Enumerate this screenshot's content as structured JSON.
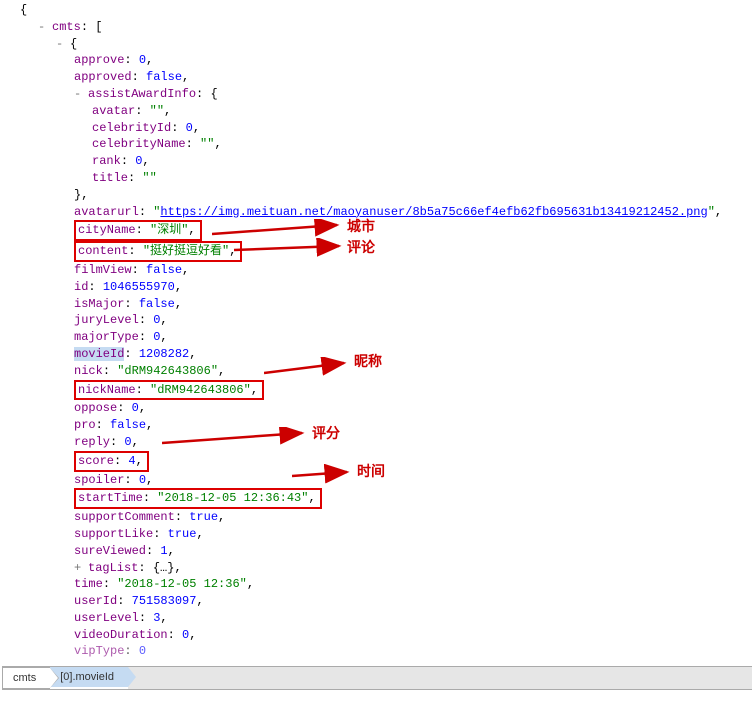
{
  "tree": {
    "open_brace": "{",
    "cmts_key": "cmts",
    "open_bracket": "[",
    "item_open": "{",
    "approve_k": "approve",
    "approve_v": "0",
    "approved_k": "approved",
    "approved_v": "false",
    "assist_k": "assistAwardInfo",
    "assist_open": "{",
    "avatar_k": "avatar",
    "avatar_v": "\"\"",
    "celebId_k": "celebrityId",
    "celebId_v": "0",
    "celebName_k": "celebrityName",
    "celebName_v": "\"\"",
    "rank_k": "rank",
    "rank_v": "0",
    "title_k": "title",
    "title_v": "\"\"",
    "assist_close": "}",
    "avatarurl_k": "avatarurl",
    "avatarurl_q": "\"",
    "avatarurl_link": "https://img.meituan.net/maoyanuser/8b5a75c66ef4efb62fb695631b13419212452.png",
    "cityName_k": "cityName",
    "cityName_v": "\"深圳\"",
    "content_k": "content",
    "content_v": "\"挺好挺逗好看\"",
    "filmView_k": "filmView",
    "filmView_v": "false",
    "id_k": "id",
    "id_v": "1046555970",
    "isMajor_k": "isMajor",
    "isMajor_v": "false",
    "juryLevel_k": "juryLevel",
    "juryLevel_v": "0",
    "majorType_k": "majorType",
    "majorType_v": "0",
    "movieId_k": "movieId",
    "movieId_v": "1208282",
    "nick_k": "nick",
    "nick_v": "\"dRM942643806\"",
    "nickName_k": "nickName",
    "nickName_v": "\"dRM942643806\"",
    "oppose_k": "oppose",
    "oppose_v": "0",
    "pro_k": "pro",
    "pro_v": "false",
    "reply_k": "reply",
    "reply_v": "0",
    "score_k": "score",
    "score_v": "4",
    "spoiler_k": "spoiler",
    "spoiler_v": "0",
    "startTime_k": "startTime",
    "startTime_v": "\"2018-12-05 12:36:43\"",
    "supportComment_k": "supportComment",
    "supportComment_v": "true",
    "supportLike_k": "supportLike",
    "supportLike_v": "true",
    "sureViewed_k": "sureViewed",
    "sureViewed_v": "1",
    "tagList_k": "tagList",
    "tagList_v": "{…}",
    "time_k": "time",
    "time_v": "\"2018-12-05 12:36\"",
    "userId_k": "userId",
    "userId_v": "751583097",
    "userLevel_k": "userLevel",
    "userLevel_v": "3",
    "videoDuration_k": "videoDuration",
    "videoDuration_v": "0",
    "vipType_k": "vipType",
    "vipType_v": "0"
  },
  "annotations": {
    "city": "城市",
    "comment": "评论",
    "nick": "昵称",
    "score": "评分",
    "time": "时间"
  },
  "breadcrumb": {
    "seg1": "cmts",
    "seg2": "[0].movieId"
  },
  "annot_color": "#c00",
  "box_color": "#d00"
}
